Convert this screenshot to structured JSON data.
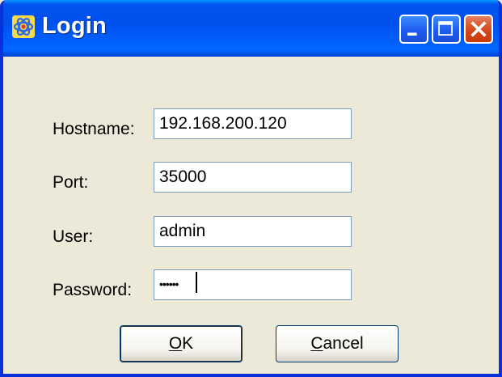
{
  "window": {
    "title": "Login"
  },
  "form": {
    "hostname_label": "Hostname:",
    "hostname_value": "192.168.200.120",
    "port_label": "Port:",
    "port_value": "35000",
    "user_label": "User:",
    "user_value": "admin",
    "password_label": "Password:",
    "password_mask": "••••••"
  },
  "buttons": {
    "ok_prefix": "O",
    "ok_rest": "K",
    "cancel_prefix": "C",
    "cancel_rest": "ancel"
  },
  "icons": {
    "app": "atom-icon",
    "minimize": "minimize-icon",
    "maximize": "maximize-icon",
    "close": "close-icon"
  },
  "colors": {
    "titlebar": "#0053ee",
    "window_bg": "#ece9d8",
    "close_button": "#d34a1c",
    "input_border": "#7f9db9"
  }
}
